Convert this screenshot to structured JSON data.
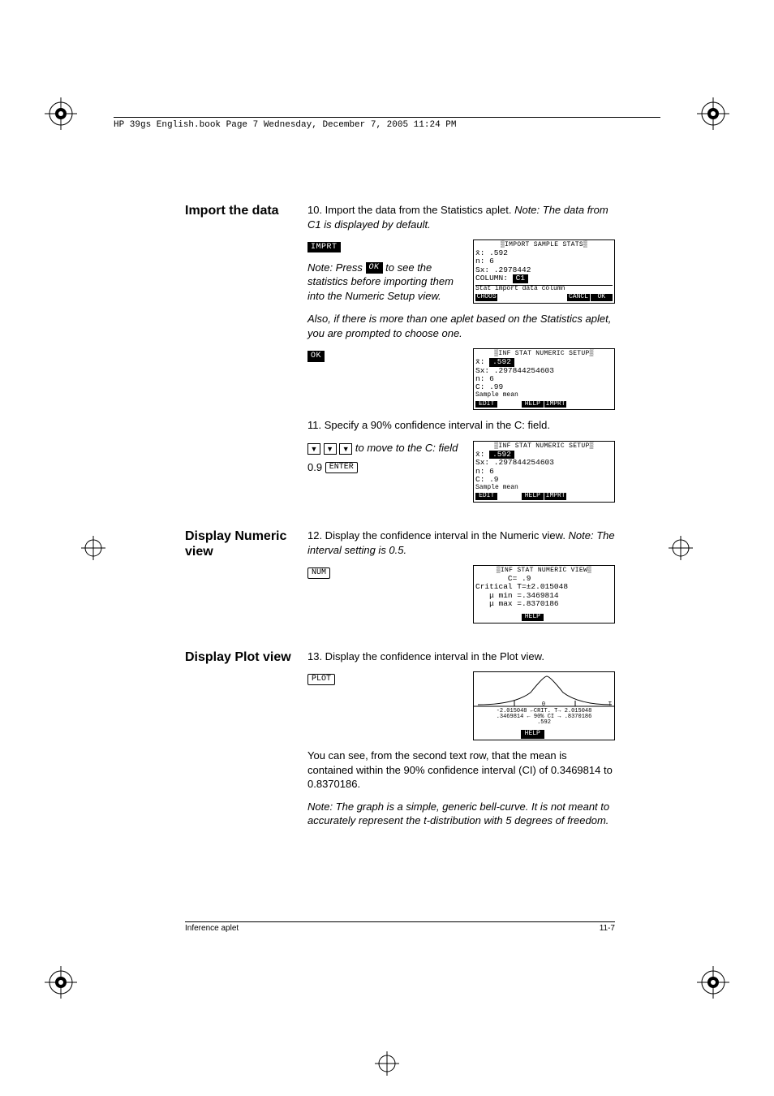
{
  "headerline": "HP 39gs English.book  Page 7  Wednesday, December 7, 2005  11:24 PM",
  "sections": {
    "import": {
      "label": "Import the data",
      "step10": "10. Import the data from the Statistics aplet. ",
      "step10_note": "Note: The data from C1 is displayed by default.",
      "softkey_imprt": "IMPRT",
      "note_press": "Note: Press ",
      "softkey_ok": "OK",
      "note_press2": " to see the statistics before importing them into the Numeric Setup view.",
      "note_also": "Also, if there is more than one aplet based on the Statistics aplet, you are prompted to choose one.",
      "step11": "11. Specify a 90% confidence interval in the C: field.",
      "move_note": "to move to the C: field",
      "val09": "0.9",
      "key_enter": "ENTER"
    },
    "numeric": {
      "label": "Display Numeric view",
      "step12": "12. Display the confidence interval in the Numeric view. ",
      "step12_note": "Note: The interval setting is 0.5.",
      "key_num": "NUM"
    },
    "plot": {
      "label": "Display Plot view",
      "step13": "13. Display the confidence interval in the Plot view.",
      "key_plot": "PLOT",
      "para": "You can see, from the second text row, that the mean is contained within the 90% confidence interval (CI) of 0.3469814 to 0.8370186.",
      "note": "Note: The graph is a simple, generic bell-curve. It is not meant to accurately represent the t-distribution with 5 degrees of freedom."
    }
  },
  "screens": {
    "import_sample": {
      "title": "▒IMPORT SAMPLE STATS▒",
      "l1": "x̄: .592",
      "l2": "n: 6",
      "l3": "Sx: .2978442",
      "l4": "COLUMN:",
      "l4_hl": "C1",
      "status": "Stat import data column",
      "menu": [
        "CHOOS",
        "",
        "",
        "",
        "CANCL",
        "OK"
      ]
    },
    "setup1": {
      "title": "▒INF STAT NUMERIC SETUP▒",
      "l1_pre": "x̄:",
      "l1_hl": ".592",
      "l2": "Sx: .297844254603",
      "l3": "n: 6",
      "l4": "C: .99",
      "status": "Sample mean",
      "menu": [
        "EDIT",
        "",
        "HELP",
        "IMPRT",
        "",
        ""
      ]
    },
    "setup2": {
      "title": "▒INF STAT NUMERIC SETUP▒",
      "l1_pre": "x̄:",
      "l1_hl": ".592",
      "l2": "Sx: .297844254603",
      "l3": "n: 6",
      "l4": "C: .9",
      "status": "Sample mean",
      "menu": [
        "EDIT",
        "",
        "HELP",
        "IMPRT",
        "",
        ""
      ]
    },
    "numeric_view": {
      "title": "▒INF STAT NUMERIC VIEW▒",
      "l1": "       C= .9",
      "l2": "Critical T=±2.015048",
      "l3": "   μ min =.3469814",
      "l4": "   μ max =.8370186",
      "menu": [
        "",
        "",
        "HELP",
        "",
        "",
        ""
      ]
    },
    "plot_view": {
      "row1": "-2.015048 ←CRIT. T→ 2.015048",
      "row2": ".3469814 ← 90% CI → .8370186",
      "row3": ".592",
      "menu": [
        "",
        "",
        "HELP",
        "",
        "",
        ""
      ]
    }
  },
  "footer": {
    "left": "Inference aplet",
    "right": "11-7"
  },
  "chart_data": {
    "type": "line",
    "title": "t-distribution confidence interval plot",
    "xlabel": "T",
    "ylabel": "",
    "critical_t_low": -2.015048,
    "critical_t_high": 2.015048,
    "ci_low": 0.3469814,
    "ci_high": 0.8370186,
    "mean": 0.592,
    "ci_level": 0.9
  }
}
